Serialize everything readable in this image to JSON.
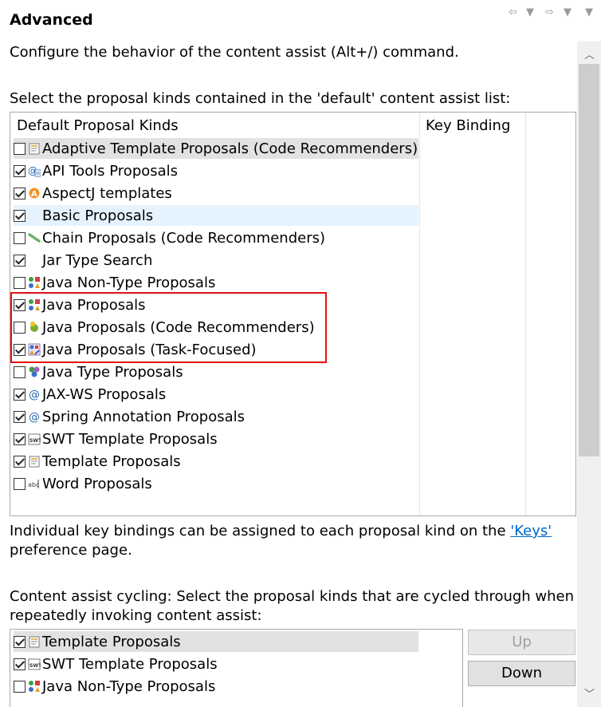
{
  "header": {
    "title": "Advanced"
  },
  "intro": {
    "description": "Configure the behavior of the content assist (Alt+/) command.",
    "select_label": "Select the proposal kinds contained in the 'default' content assist list:"
  },
  "default_list": {
    "columns": [
      "Default Proposal Kinds",
      "Key Binding"
    ],
    "items": [
      {
        "label": "Adaptive Template Proposals (Code Recommenders)",
        "checked": false,
        "icon": "template-icon"
      },
      {
        "label": "API Tools Proposals",
        "checked": true,
        "icon": "api-tools-icon"
      },
      {
        "label": "AspectJ templates",
        "checked": true,
        "icon": "aspectj-icon"
      },
      {
        "label": "Basic Proposals",
        "checked": true,
        "icon": "none"
      },
      {
        "label": "Chain Proposals (Code Recommenders)",
        "checked": false,
        "icon": "chain-icon"
      },
      {
        "label": "Jar Type Search",
        "checked": true,
        "icon": "none"
      },
      {
        "label": "Java Non-Type Proposals",
        "checked": false,
        "icon": "java-shapes-icon"
      },
      {
        "label": "Java Proposals",
        "checked": true,
        "icon": "java-shapes-icon"
      },
      {
        "label": "Java Proposals (Code Recommenders)",
        "checked": false,
        "icon": "recommenders-icon"
      },
      {
        "label": "Java Proposals (Task-Focused)",
        "checked": true,
        "icon": "task-focused-icon"
      },
      {
        "label": "Java Type Proposals",
        "checked": false,
        "icon": "java-type-icon"
      },
      {
        "label": "JAX-WS Proposals",
        "checked": true,
        "icon": "at-icon"
      },
      {
        "label": "Spring Annotation Proposals",
        "checked": true,
        "icon": "at-icon"
      },
      {
        "label": "SWT Template Proposals",
        "checked": true,
        "icon": "swt-icon"
      },
      {
        "label": "Template Proposals",
        "checked": true,
        "icon": "template-icon"
      },
      {
        "label": "Word Proposals",
        "checked": false,
        "icon": "word-icon"
      }
    ]
  },
  "key_binding_note": {
    "prefix": "Individual key bindings can be assigned to each proposal kind on the ",
    "link": "'Keys'",
    "suffix": "preference page."
  },
  "cycling": {
    "label_line1": "Content assist cycling: Select the proposal kinds that are cycled through when",
    "label_line2": "repeatedly invoking content assist:",
    "items": [
      {
        "label": "Template Proposals",
        "checked": true,
        "icon": "template-icon"
      },
      {
        "label": "SWT Template Proposals",
        "checked": true,
        "icon": "swt-icon"
      },
      {
        "label": "Java Non-Type Proposals",
        "checked": false,
        "icon": "java-shapes-icon"
      }
    ],
    "up_label": "Up",
    "down_label": "Down"
  },
  "colors": {
    "highlight_border": "#e01010",
    "selection_gray": "#e2e2e2",
    "selection_blue": "#e5f3ff",
    "link": "#0066cc"
  }
}
